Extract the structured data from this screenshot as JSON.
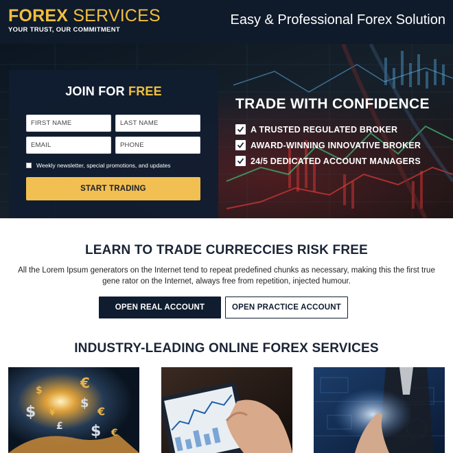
{
  "header": {
    "logo_strong": "FOREX",
    "logo_light": "SERVICES",
    "logo_tagline": "YOUR TRUST, OUR COMMITMENT",
    "tagline": "Easy & Professional Forex Solution"
  },
  "form": {
    "title_prefix": "JOIN FOR",
    "title_accent": "FREE",
    "first_name_placeholder": "FIRST NAME",
    "last_name_placeholder": "LAST NAME",
    "email_placeholder": "EMAIL",
    "phone_placeholder": "PHONE",
    "newsletter_label": "Weekly newsletter, special promotions, and updates",
    "submit_label": "START TRADING"
  },
  "hero": {
    "title": "TRADE WITH CONFIDENCE",
    "benefits": [
      "A TRUSTED REGULATED BROKER",
      "AWARD-WINNING INNOVATIVE BROKER",
      "24/5 DEDICATED ACCOUNT MANAGERS"
    ]
  },
  "learn": {
    "title": "LEARN TO TRADE CURRECCIES RISK FREE",
    "text": "All the Lorem Ipsum generators on the Internet tend to repeat predefined chunks as necessary, making this the first true gene rator on the Internet, always free from repetition, injected humour.",
    "real_account_label": "OPEN REAL ACCOUNT",
    "practice_account_label": "OPEN PRACTICE ACCOUNT"
  },
  "services": {
    "title": "INDUSTRY-LEADING ONLINE FOREX SERVICES",
    "tiles": [
      "currency-hand-image",
      "tablet-chart-image",
      "touchscreen-businessman-image"
    ]
  },
  "colors": {
    "navy": "#101d30",
    "gold": "#f2bf3e",
    "button_gold": "#f2bf52"
  }
}
